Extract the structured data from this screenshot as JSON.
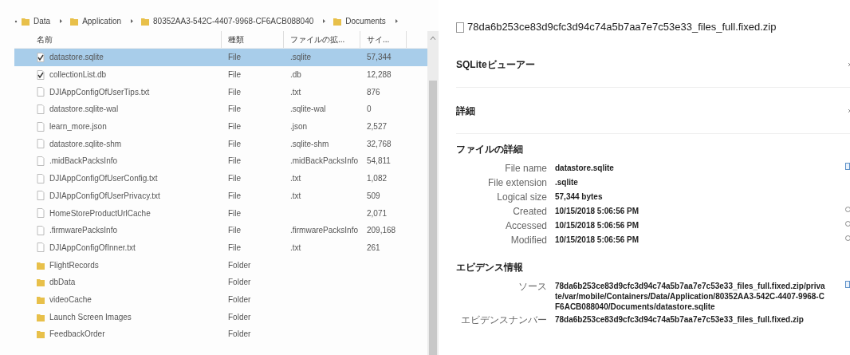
{
  "explorer": {
    "breadcrumb": [
      "Data",
      "Application",
      "80352AA3-542C-4407-9968-CF6ACB088040",
      "Documents"
    ],
    "columns": [
      "名前",
      "種類",
      "ファイルの拡...",
      "サイ..."
    ],
    "rows": [
      {
        "kind": "file",
        "checked": true,
        "selected": true,
        "name": "datastore.sqlite",
        "type": "File",
        "ext": ".sqlite",
        "size": "57,344"
      },
      {
        "kind": "file",
        "checked": true,
        "selected": false,
        "name": "collectionList.db",
        "type": "File",
        "ext": ".db",
        "size": "12,288"
      },
      {
        "kind": "file",
        "checked": false,
        "selected": false,
        "name": "DJIAppConfigOfUserTips.txt",
        "type": "File",
        "ext": ".txt",
        "size": "876"
      },
      {
        "kind": "file",
        "checked": false,
        "selected": false,
        "name": "datastore.sqlite-wal",
        "type": "File",
        "ext": ".sqlite-wal",
        "size": "0"
      },
      {
        "kind": "file",
        "checked": false,
        "selected": false,
        "name": "learn_more.json",
        "type": "File",
        "ext": ".json",
        "size": "2,527"
      },
      {
        "kind": "file",
        "checked": false,
        "selected": false,
        "name": "datastore.sqlite-shm",
        "type": "File",
        "ext": ".sqlite-shm",
        "size": "32,768"
      },
      {
        "kind": "file",
        "checked": false,
        "selected": false,
        "name": ".midBackPacksInfo",
        "type": "File",
        "ext": ".midBackPacksInfo",
        "size": "54,811"
      },
      {
        "kind": "file",
        "checked": false,
        "selected": false,
        "name": "DJIAppConfigOfUserConfig.txt",
        "type": "File",
        "ext": ".txt",
        "size": "1,082"
      },
      {
        "kind": "file",
        "checked": false,
        "selected": false,
        "name": "DJIAppConfigOfUserPrivacy.txt",
        "type": "File",
        "ext": ".txt",
        "size": "509"
      },
      {
        "kind": "file",
        "checked": false,
        "selected": false,
        "name": "HomeStoreProductUrlCache",
        "type": "File",
        "size": "2,071"
      },
      {
        "kind": "file",
        "checked": false,
        "selected": false,
        "name": ".firmwarePacksInfo",
        "type": "File",
        "ext": ".firmwarePacksInfo",
        "size": "209,168"
      },
      {
        "kind": "file",
        "checked": false,
        "selected": false,
        "name": "DJIAppConfigOfInner.txt",
        "type": "File",
        "ext": ".txt",
        "size": "261"
      },
      {
        "kind": "folder",
        "selected": false,
        "name": "FlightRecords",
        "type": "Folder"
      },
      {
        "kind": "folder",
        "selected": false,
        "name": "dbData",
        "type": "Folder"
      },
      {
        "kind": "folder",
        "selected": false,
        "name": "videoCache",
        "type": "Folder"
      },
      {
        "kind": "folder",
        "selected": false,
        "name": "Launch Screen Images",
        "type": "Folder"
      },
      {
        "kind": "folder",
        "selected": false,
        "name": "FeedbackOrder",
        "type": "Folder"
      }
    ]
  },
  "details": {
    "title": "78da6b253ce83d9cfc3d94c74a5b7aa7e7c53e33_files_full.fixed.zip",
    "sections": [
      {
        "title": "SQLiteビューアー"
      },
      {
        "title": "詳細"
      }
    ],
    "file_details": {
      "title": "ファイルの詳細",
      "fields": [
        {
          "label": "File name",
          "value": "datastore.sqlite"
        },
        {
          "label": "File extension",
          "value": ".sqlite"
        },
        {
          "label": "Logical size",
          "value": "57,344 bytes"
        },
        {
          "label": "Created",
          "value": "10/15/2018 5:06:56 PM"
        },
        {
          "label": "Accessed",
          "value": "10/15/2018 5:06:56 PM"
        },
        {
          "label": "Modified",
          "value": "10/15/2018 5:06:56 PM"
        }
      ]
    },
    "evidence": {
      "title": "エビデンス情報",
      "fields": [
        {
          "label": "ソース",
          "value": "78da6b253ce83d9cfc3d94c74a5b7aa7e7c53e33_files_full.fixed.zip/private/var/mobile/Containers/Data/Application/80352AA3-542C-4407-9968-CF6ACB088040/Documents/datastore.sqlite"
        },
        {
          "label": "エビデンスナンバー",
          "value": "78da6b253ce83d9cfc3d94c74a5b7aa7e7c53e33_files_full.fixed.zip"
        }
      ]
    }
  }
}
